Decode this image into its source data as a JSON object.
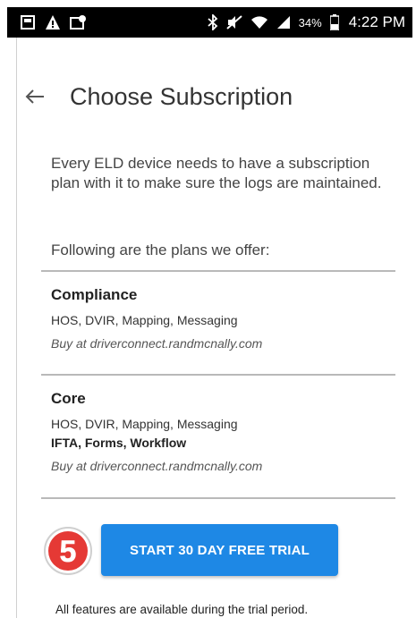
{
  "status_bar": {
    "battery_text": "34%",
    "time": "4:22 PM"
  },
  "header": {
    "title": "Choose Subscription"
  },
  "intro": {
    "description": "Every ELD device needs to have a subscription plan with it to make sure the logs are maintained.",
    "offer_text": "Following are the plans we offer:"
  },
  "plans": [
    {
      "name": "Compliance",
      "features": "HOS, DVIR, Mapping, Messaging",
      "buy_text": "Buy at driverconnect.randmcnally.com"
    },
    {
      "name": "Core",
      "features": "HOS, DVIR, Mapping, Messaging",
      "extra_features": "IFTA, Forms, Workflow",
      "buy_text": "Buy at driverconnect.randmcnally.com"
    }
  ],
  "trial": {
    "button_label": "START 30 DAY FREE TRIAL",
    "step_number": "5",
    "note": "All features are available during the trial period."
  },
  "colors": {
    "accent": "#1e88e5",
    "badge_red": "#e53935"
  }
}
